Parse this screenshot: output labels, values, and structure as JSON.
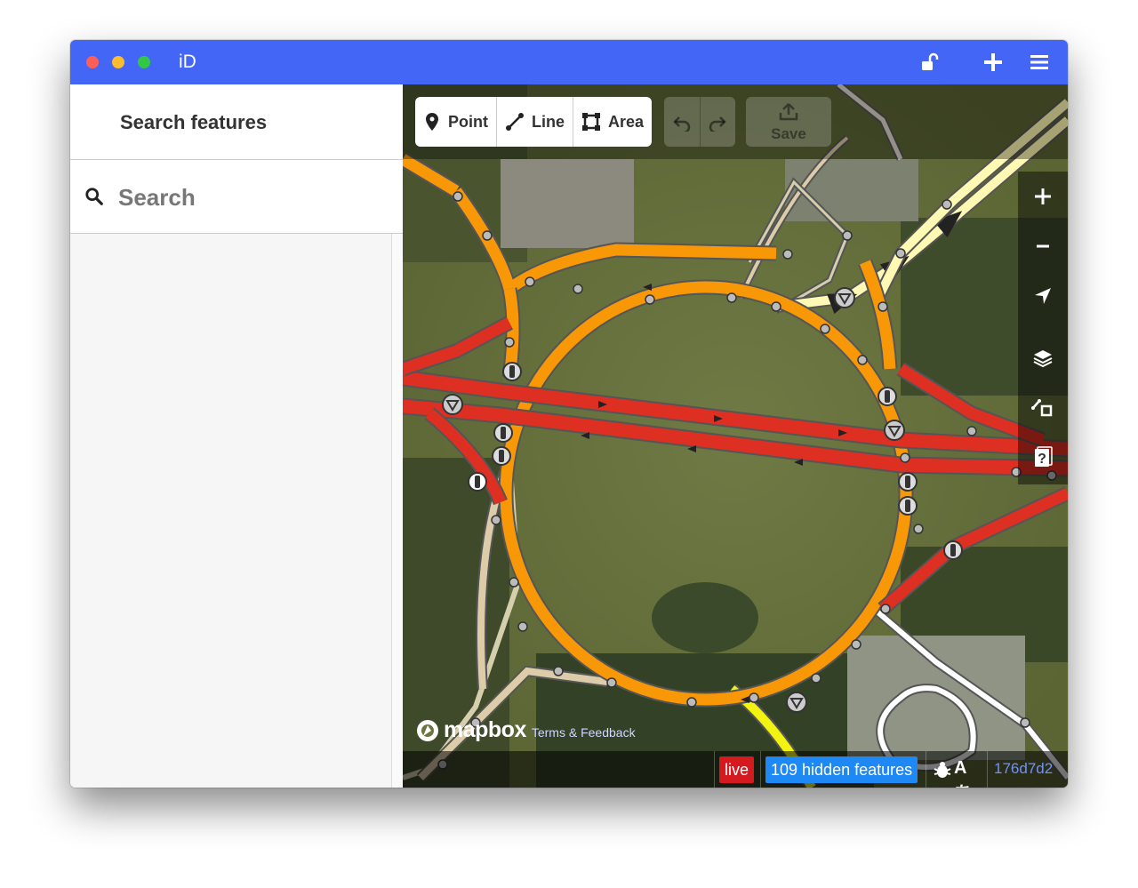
{
  "window": {
    "title": "iD",
    "controls": [
      "close",
      "minimize",
      "zoom"
    ],
    "toolbar_icons": [
      "unlock-icon",
      "plus-icon",
      "menu-icon"
    ]
  },
  "sidebar": {
    "header_title": "Search features",
    "search_placeholder": "Search"
  },
  "map": {
    "modes": [
      {
        "label": "Point",
        "icon": "point-icon"
      },
      {
        "label": "Line",
        "icon": "line-icon"
      },
      {
        "label": "Area",
        "icon": "area-icon"
      }
    ],
    "undo_icon": "undo-icon",
    "redo_icon": "redo-icon",
    "save_label": "Save",
    "controls": [
      "zoom-in-icon",
      "zoom-out-icon",
      "geolocate-icon",
      "layers-icon",
      "map-data-icon",
      "help-icon"
    ],
    "attribution": {
      "logo_text": "mapbox",
      "terms_text": "Terms & Feedback"
    },
    "footer": {
      "live_label": "live",
      "hidden_features_label": "109 hidden features",
      "lang_label": "Aあ",
      "version": "176d7d2"
    }
  },
  "colors": {
    "titlebar": "#4366f7",
    "trunk": "#dd2f22",
    "primary": "#f99806",
    "secondary": "#f3f312",
    "tertiary": "#fff9b3",
    "unclassified": "#ddccaa",
    "live": "#d4191f",
    "hidden_badge": "#1e88f5",
    "version_link": "#7092ff"
  }
}
